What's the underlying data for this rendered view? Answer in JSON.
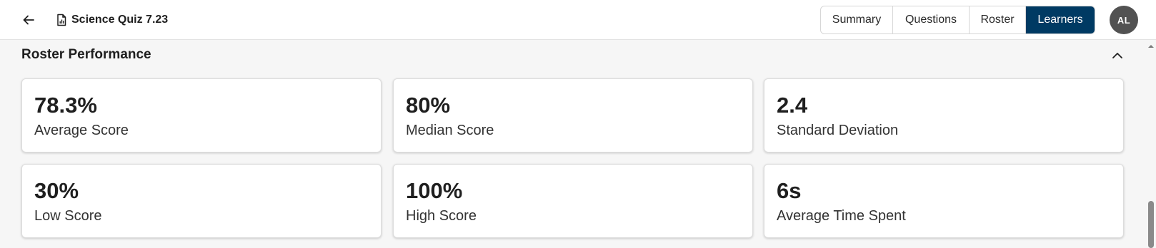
{
  "header": {
    "back_icon": "arrow-left-icon",
    "doc_icon": "document-chart-icon",
    "title": "Science Quiz 7.23",
    "tabs": [
      {
        "label": "Summary",
        "active": false
      },
      {
        "label": "Questions",
        "active": false
      },
      {
        "label": "Roster",
        "active": false
      },
      {
        "label": "Learners",
        "active": true
      }
    ],
    "avatar_initials": "AL"
  },
  "section": {
    "title": "Roster Performance",
    "collapse_icon": "chevron-up-icon"
  },
  "stats": [
    {
      "value": "78.3%",
      "label": "Average Score"
    },
    {
      "value": "80%",
      "label": "Median Score"
    },
    {
      "value": "2.4",
      "label": "Standard Deviation"
    },
    {
      "value": "30%",
      "label": "Low Score"
    },
    {
      "value": "100%",
      "label": "High Score"
    },
    {
      "value": "6s",
      "label": "Average Time Spent"
    }
  ],
  "colors": {
    "active_tab": "#003a63",
    "avatar_bg": "#525252",
    "page_bg": "#f6f6f6"
  }
}
